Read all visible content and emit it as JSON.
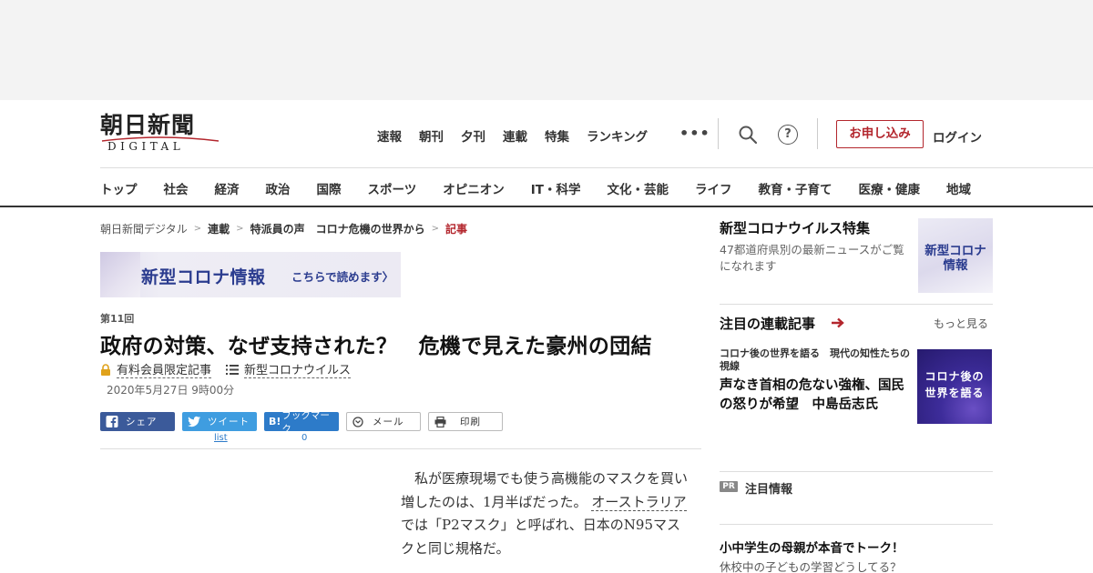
{
  "header": {
    "logo_jp": "朝日新聞",
    "logo_en": "DIGITAL",
    "top_nav": [
      "速報",
      "朝刊",
      "夕刊",
      "連載",
      "特集",
      "ランキング"
    ],
    "more_icon": "•••",
    "help_icon": "?",
    "apply_label": "お申し込み",
    "login_label": "ログイン"
  },
  "category_nav": [
    "トップ",
    "社会",
    "経済",
    "政治",
    "国際",
    "スポーツ",
    "オピニオン",
    "IT・科学",
    "文化・芸能",
    "ライフ",
    "教育・子育て",
    "医療・健康",
    "地域"
  ],
  "breadcrumb": {
    "items": [
      "朝日新聞デジタル",
      "連載",
      "特派員の声　コロナ危機の世界から"
    ],
    "current": "記事"
  },
  "corona_banner": {
    "title": "新型コロナ情報",
    "cta": "こちらで読めます〉"
  },
  "article": {
    "series_no": "第11回",
    "title": "政府の対策、なぜ支持された？　危機で見えた豪州の団結",
    "paid_tag": "有料会員限定記事",
    "topic_tag": "新型コロナウイルス",
    "date": "2020年5月27日 9時00分",
    "body_p1_a": "私が医療現場でも使う高機能のマスクを買い増したのは、1月半ばだった。",
    "body_p1_link": "オーストラリア",
    "body_p1_b": "では「P2マスク」と呼ばれ、日本のN95マスクと同じ規格だ。"
  },
  "share": {
    "facebook": "シェア",
    "twitter": "ツイート",
    "hatena": "ブックマーク",
    "hatena_icon": "B!",
    "mail": "メール",
    "print": "印刷",
    "twitter_count": "list",
    "hatena_count": "0"
  },
  "sidebar": {
    "feature": {
      "title": "新型コロナウイルス特集",
      "desc": "47都道府県別の最新ニュースがご覧になれます",
      "img_line1": "新型コロナ",
      "img_line2": "情報"
    },
    "serials": {
      "title": "注目の連載記事",
      "more": "もっと見る",
      "label": "コロナ後の世界を語る　現代の知性たちの視線",
      "headline": "声なき首相の危ない強権、国民の怒りが希望　中島岳志氏",
      "img_line1": "コロナ後の",
      "img_line2": "世界を語る"
    },
    "pr": {
      "badge": "PR",
      "title": "注目情報",
      "ad_title": "小中学生の母親が本音でトーク！",
      "ad_desc": "休校中の子どもの学習どうしてる？"
    }
  },
  "colors": {
    "accent_red": "#b3262d",
    "navy": "#2b3c8f",
    "facebook": "#3b5a9a",
    "twitter": "#3f9de0",
    "hatena": "#2d7bc9"
  }
}
